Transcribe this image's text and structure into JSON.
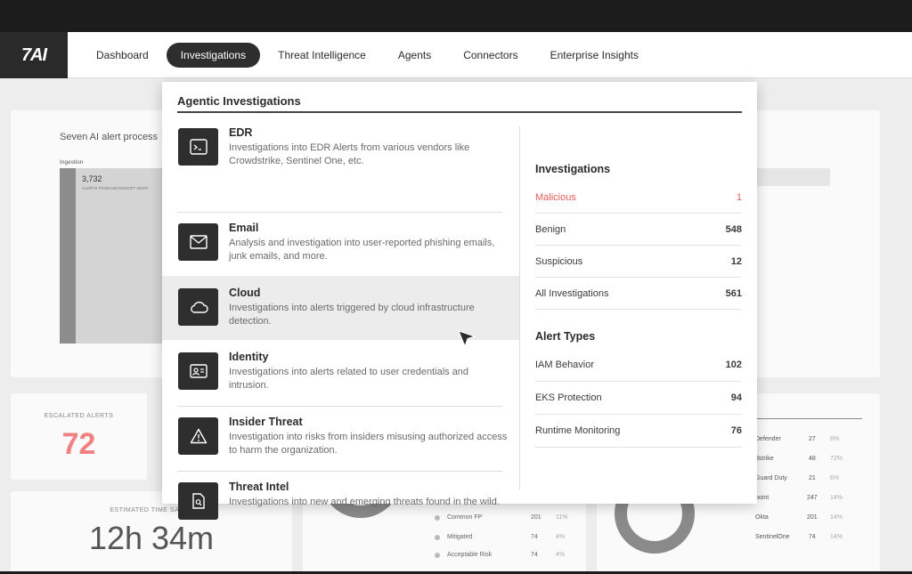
{
  "app": {
    "logo": "7AI"
  },
  "nav": {
    "items": [
      {
        "label": "Dashboard"
      },
      {
        "label": "Investigations"
      },
      {
        "label": "Threat Intelligence"
      },
      {
        "label": "Agents"
      },
      {
        "label": "Connectors"
      },
      {
        "label": "Enterprise Insights"
      }
    ],
    "active": "Investigations"
  },
  "background": {
    "panel_title": "Seven AI alert process",
    "ingestion_label": "Ingestion",
    "ingestion_count": "3,732",
    "ingestion_sub": "ALERTS FROM MICROSOFT SENTI",
    "escalated_label": "ESCALATED ALERTS",
    "escalated_value": "72",
    "estimated_label": "ESTIMATED TIME SAVED",
    "estimated_value": "12h 34m",
    "legend": [
      {
        "label": "Common FP",
        "value": "201",
        "pct": "11%"
      },
      {
        "label": "Mitigated",
        "value": "74",
        "pct": "4%"
      },
      {
        "label": "Acceptable Risk",
        "value": "74",
        "pct": "4%"
      }
    ],
    "right_table": [
      {
        "label": "Defender",
        "value": "27",
        "pct": "6%"
      },
      {
        "label": "dstrike",
        "value": "48",
        "pct": "72%"
      },
      {
        "label": "Guard Duty",
        "value": "21",
        "pct": "6%"
      },
      {
        "label": "point",
        "value": "247",
        "pct": "14%"
      },
      {
        "label": "Okta",
        "value": "201",
        "pct": "14%"
      },
      {
        "label": "SentinelOne",
        "value": "74",
        "pct": "14%"
      }
    ]
  },
  "dropdown": {
    "heading": "Agentic Investigations",
    "items": [
      {
        "title": "EDR",
        "desc": "Investigations into EDR Alerts from various vendors like Crowdstrike, Sentinel One, etc.",
        "icon": "terminal-icon"
      },
      {
        "title": "Email",
        "desc": "Analysis and investigation into user-reported phishing emails, junk emails, and more.",
        "icon": "envelope-icon"
      },
      {
        "title": "Cloud",
        "desc": "Investigations into alerts triggered by cloud infrastructure detection.",
        "icon": "cloud-icon"
      },
      {
        "title": "Identity",
        "desc": "Investigations into alerts related to user credentials and intrusion.",
        "icon": "id-card-icon"
      },
      {
        "title": "Insider Threat",
        "desc": "Investigation into risks from insiders misusing authorized access to harm the organization.",
        "icon": "warning-icon"
      },
      {
        "title": "Threat Intel",
        "desc": "Investigations into new and emerging threats found in the wild.",
        "icon": "document-search-icon"
      }
    ],
    "investigations_heading": "Investigations",
    "investigations": [
      {
        "label": "Malicious",
        "value": "1"
      },
      {
        "label": "Benign",
        "value": "548"
      },
      {
        "label": "Suspicious",
        "value": "12"
      },
      {
        "label": "All Investigations",
        "value": "561"
      }
    ],
    "alert_types_heading": "Alert Types",
    "alert_types": [
      {
        "label": "IAM Behavior",
        "value": "102"
      },
      {
        "label": "EKS Protection",
        "value": "94"
      },
      {
        "label": "Runtime Monitoring",
        "value": "76"
      }
    ]
  },
  "colors": {
    "accent_red": "#e85d5d",
    "escalated_red": "#f08181",
    "dark": "#2e2e2e"
  }
}
